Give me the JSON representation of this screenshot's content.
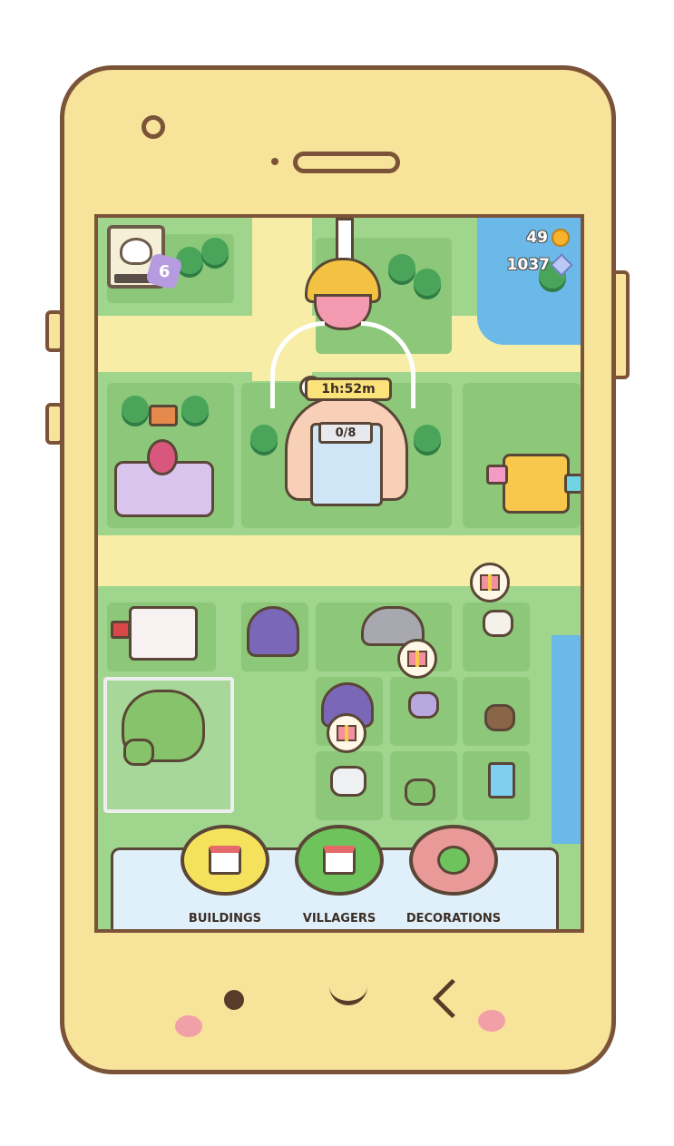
{
  "hud": {
    "level": "6",
    "coins": "49",
    "gems": "1037"
  },
  "building": {
    "timer": "1h:52m",
    "capacity": "0/8"
  },
  "toolbar": {
    "buildings_label": "BUILDINGS",
    "villagers_label": "VILLAGERS",
    "decorations_label": "DECORATIONS"
  },
  "colors": {
    "phone_body": "#f8e39a",
    "phone_outline": "#7a5338",
    "buildings_button": "#f5e25c",
    "villagers_button": "#6fc35c",
    "decorations_button": "#e99a98"
  }
}
